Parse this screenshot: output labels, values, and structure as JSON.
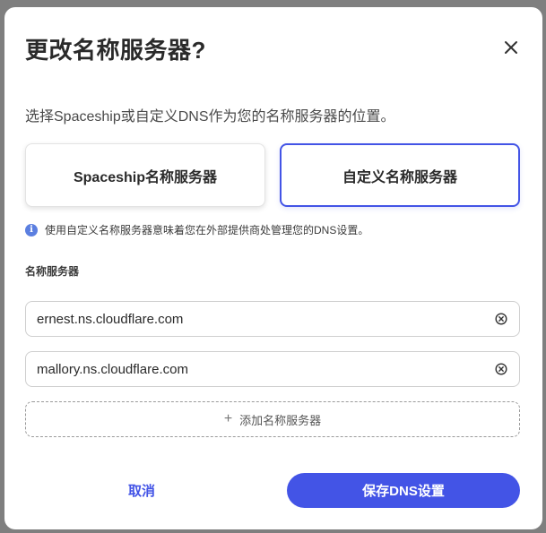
{
  "dialog": {
    "title": "更改名称服务器?",
    "subtitle": "选择Spaceship或自定义DNS作为您的名称服务器的位置。",
    "close_icon": "close-icon"
  },
  "options": {
    "spaceship_label": "Spaceship名称服务器",
    "custom_label": "自定义名称服务器",
    "selected": "custom"
  },
  "info": {
    "icon": "info-icon",
    "text": "使用自定义名称服务器意味着您在外部提供商处管理您的DNS设置。"
  },
  "nameservers": {
    "label": "名称服务器",
    "values": [
      "ernest.ns.cloudflare.com",
      "mallory.ns.cloudflare.com"
    ],
    "add_label": "添加名称服务器"
  },
  "footer": {
    "cancel_label": "取消",
    "save_label": "保存DNS设置"
  },
  "colors": {
    "accent": "#4354e6",
    "info": "#5b7fe0"
  }
}
